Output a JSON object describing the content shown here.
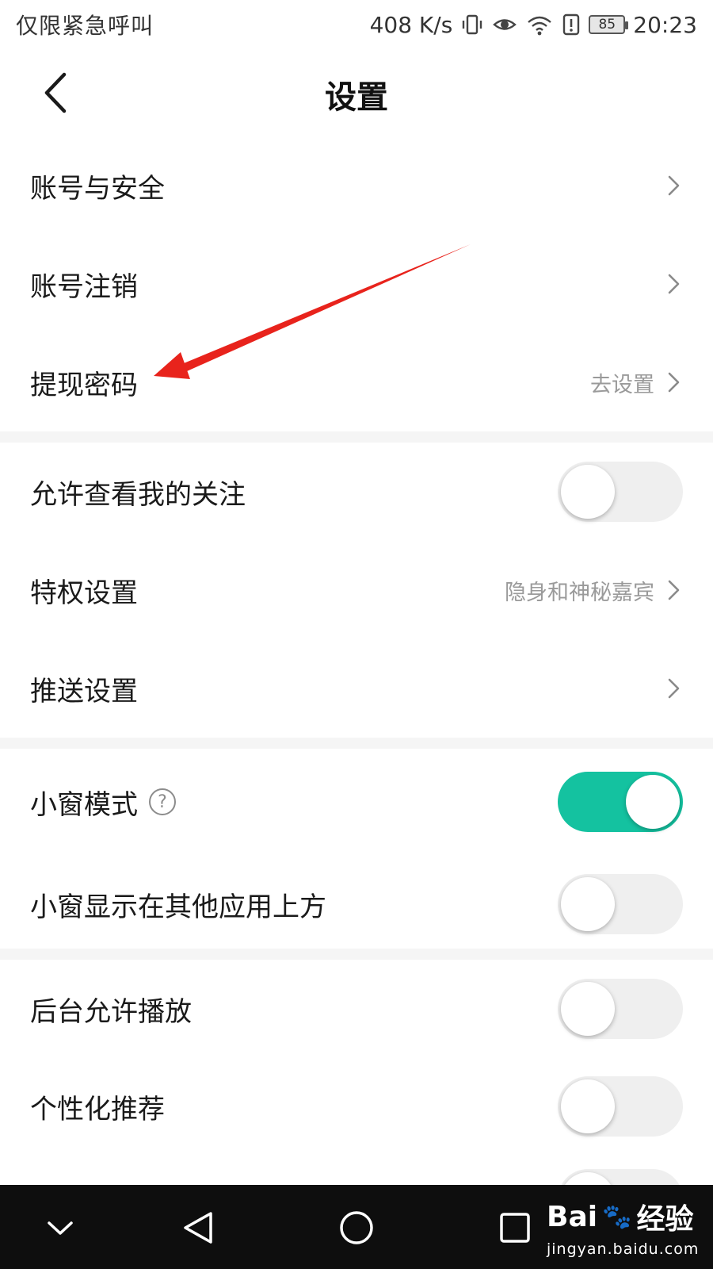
{
  "status_bar": {
    "carrier": "仅限紧急呼叫",
    "speed": "408 K/s",
    "icons": [
      "vibrate-icon",
      "eye-icon",
      "wifi-icon",
      "alert-icon",
      "battery-icon"
    ],
    "battery": "85",
    "time": "20:23"
  },
  "header": {
    "title": "设置",
    "back_icon": "back-arrow-icon"
  },
  "group1": [
    {
      "label": "账号与安全",
      "value": ""
    },
    {
      "label": "账号注销",
      "value": ""
    },
    {
      "label": "提现密码",
      "value": "去设置"
    }
  ],
  "group2": {
    "follow": {
      "label": "允许查看我的关注",
      "on": false
    },
    "privilege": {
      "label": "特权设置",
      "value": "隐身和神秘嘉宾"
    },
    "push": {
      "label": "推送设置",
      "value": ""
    }
  },
  "group3": {
    "mini_window": {
      "label": "小窗模式",
      "on": true,
      "help_icon": "question-circle-icon"
    },
    "overlay": {
      "label": "小窗显示在其他应用上方",
      "on": false
    }
  },
  "group4": {
    "background_play": {
      "label": "后台允许播放",
      "on": false
    },
    "personalized": {
      "label": "个性化推荐",
      "on": false
    }
  },
  "nav": {
    "icons": [
      "collapse-chevron-icon",
      "back-triangle-icon",
      "home-circle-icon",
      "recents-square-icon"
    ]
  },
  "watermark": {
    "brand": "Bai",
    "brand_suffix": "经验",
    "url": "jingyan.baidu.com"
  },
  "colors": {
    "accent": "#14c2a0",
    "annotation": "#e8231c",
    "secondary_text": "#9a9a9a",
    "section_gap": "#f5f5f5"
  }
}
